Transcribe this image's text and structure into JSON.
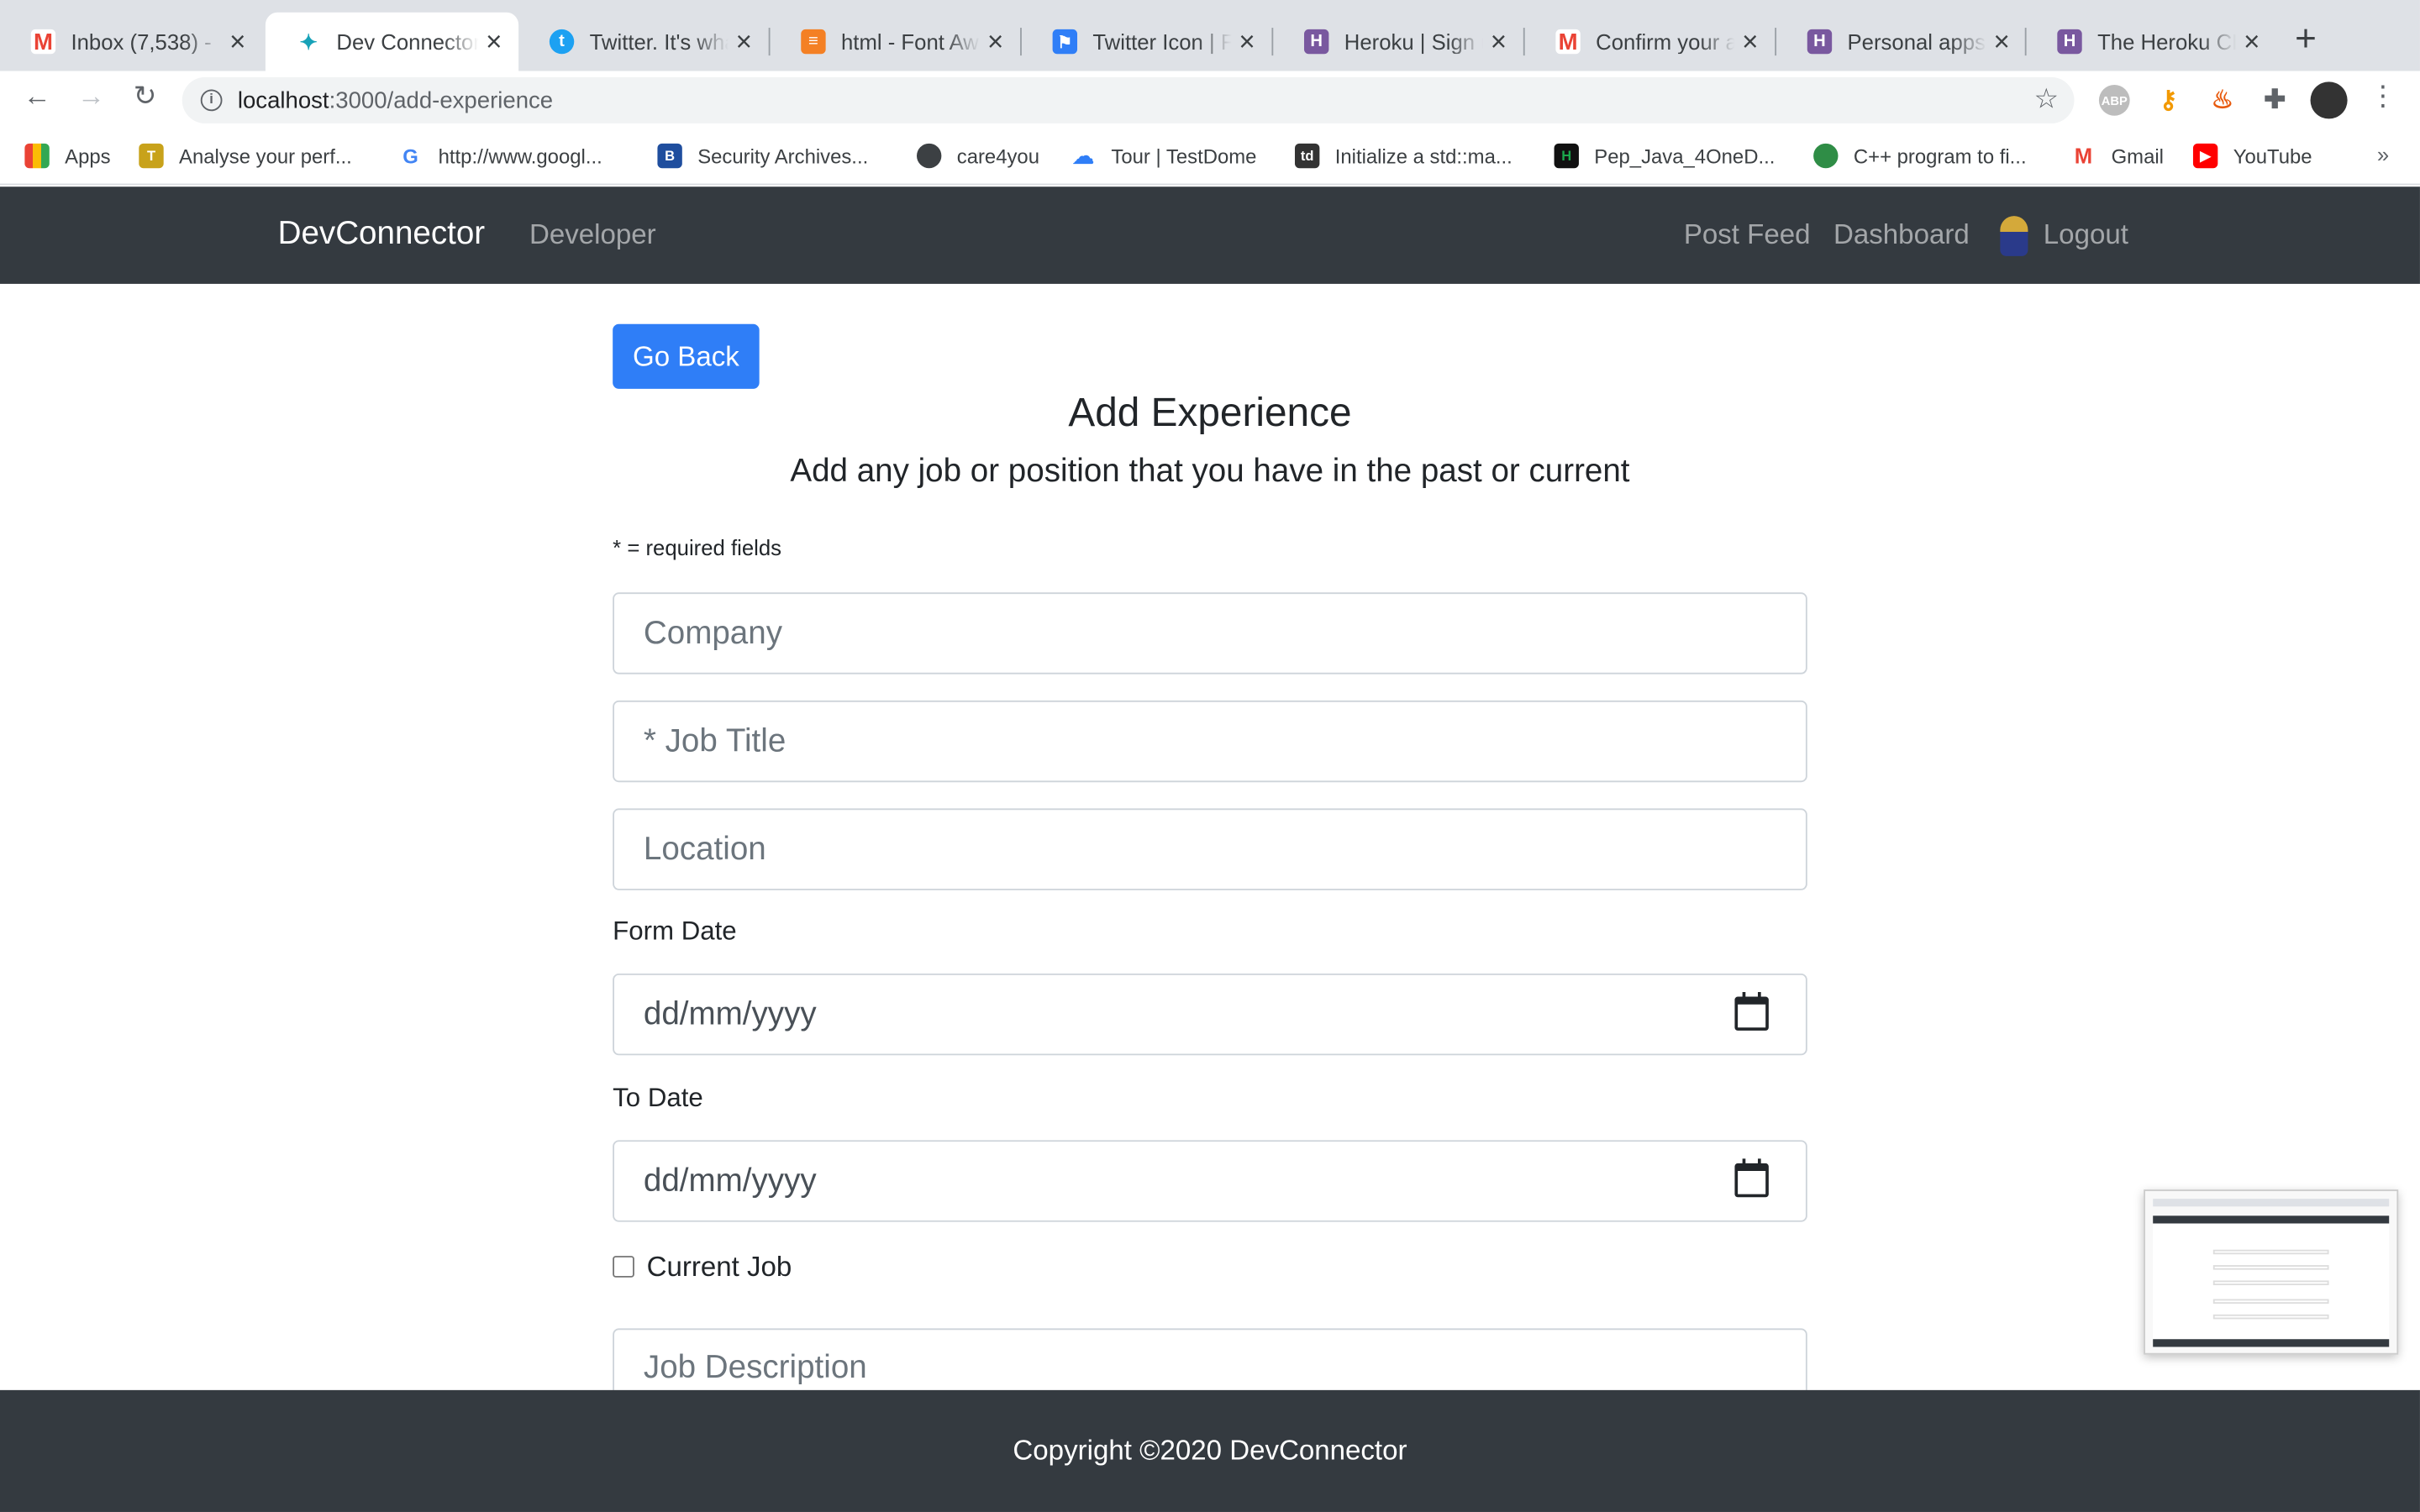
{
  "browser": {
    "tabs": [
      {
        "title": "Inbox (7,538) - ",
        "icon": "gmail-icon",
        "color": "#ea4335"
      },
      {
        "title": "Dev Connector",
        "icon": "devconnector-icon",
        "color": "#17a2b8"
      },
      {
        "title": "Twitter. It's wha",
        "icon": "twitter-icon",
        "color": "#1da1f2"
      },
      {
        "title": "html - Font Awe",
        "icon": "stackoverflow-icon",
        "color": "#f48024"
      },
      {
        "title": "Twitter Icon | F",
        "icon": "flag-icon",
        "color": "#2f7ef7"
      },
      {
        "title": "Heroku | Sign u",
        "icon": "heroku-icon",
        "color": "#79589f"
      },
      {
        "title": "Confirm your a",
        "icon": "gmail-icon",
        "color": "#ea4335"
      },
      {
        "title": "Personal apps",
        "icon": "heroku-icon",
        "color": "#79589f"
      },
      {
        "title": "The Heroku CL",
        "icon": "heroku-icon",
        "color": "#79589f"
      }
    ],
    "url_host": "localhost",
    "url_path": ":3000/add-experience",
    "bookmarks": [
      {
        "label": "Apps",
        "icon": "apps-grid-icon"
      },
      {
        "label": "Analyse your perf...",
        "icon": "ti-icon"
      },
      {
        "label": "http://www.googl...",
        "icon": "google-icon"
      },
      {
        "label": "Security Archives...",
        "icon": "b-icon"
      },
      {
        "label": "care4you",
        "icon": "globe-icon"
      },
      {
        "label": "Tour | TestDome",
        "icon": "testdome-icon"
      },
      {
        "label": "Initialize a std::ma...",
        "icon": "td-icon"
      },
      {
        "label": "Pep_Java_4OneD...",
        "icon": "hackerrank-icon"
      },
      {
        "label": "C++ program to fi...",
        "icon": "geeks-icon"
      },
      {
        "label": "Gmail",
        "icon": "gmail-icon"
      },
      {
        "label": "YouTube",
        "icon": "youtube-icon"
      }
    ]
  },
  "navbar": {
    "brand": "DevConnector",
    "developer": "Developer",
    "post_feed": "Post Feed",
    "dashboard": "Dashboard",
    "logout": "Logout"
  },
  "form": {
    "go_back": "Go Back",
    "title": "Add Experience",
    "lead": "Add any job or position that you have in the past or current",
    "required_note": "* = required fields",
    "company_placeholder": "Company",
    "job_title_placeholder": "* Job Title",
    "location_placeholder": "Location",
    "from_date_label": "Form Date",
    "from_date_value": "dd/mm/yyyy",
    "to_date_label": "To Date",
    "to_date_value": "dd/mm/yyyy",
    "current_job_label": "Current Job",
    "current_job_checked": false,
    "description_placeholder": "Job Description"
  },
  "footer": {
    "copyright": "Copyright ©2020 DevConnector"
  }
}
